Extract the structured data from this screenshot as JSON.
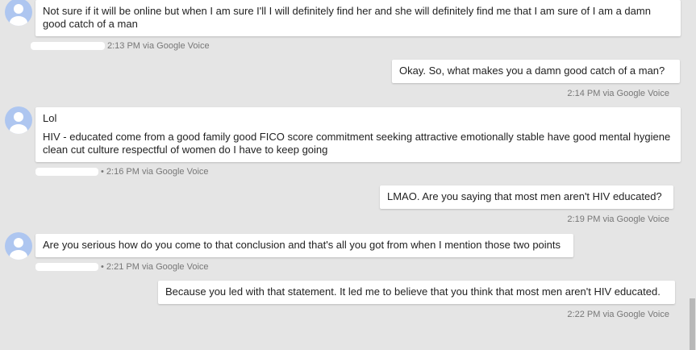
{
  "messages": [
    {
      "direction": "incoming",
      "paragraphs": [
        "Not sure if it will be online but when I am sure I'll I will definitely find her and she will definitely find me that I am sure of I am a damn good catch of a man"
      ],
      "time": "2:13 PM",
      "via": "via Google Voice"
    },
    {
      "direction": "outgoing",
      "paragraphs": [
        "Okay. So, what makes you a damn good catch of a man?"
      ],
      "time": "2:14 PM",
      "via": "via Google Voice"
    },
    {
      "direction": "incoming",
      "paragraphs": [
        "Lol",
        "HIV - educated come from a good family good FICO score commitment seeking attractive emotionally stable have good mental hygiene clean cut culture respectful of women do I have to keep going"
      ],
      "time": "2:16 PM",
      "via": "via Google Voice"
    },
    {
      "direction": "outgoing",
      "paragraphs": [
        "LMAO. Are you saying that most men aren't HIV educated?"
      ],
      "time": "2:19 PM",
      "via": "via Google Voice"
    },
    {
      "direction": "incoming",
      "paragraphs": [
        "Are you serious how do you come to that conclusion and that's all you got from when I mention those two points"
      ],
      "time": "2:21 PM",
      "via": "via Google Voice"
    },
    {
      "direction": "outgoing",
      "paragraphs": [
        "Because you led with that statement. It led me to believe that you think that most men aren't HIV educated."
      ],
      "time": "2:22 PM",
      "via": "via Google Voice"
    }
  ],
  "separator": "•",
  "icons": {
    "avatar": "default-person-avatar-icon"
  },
  "colors": {
    "background": "#e5e5e5",
    "bubble": "#ffffff",
    "avatar": "#aec6f0",
    "meta": "#777777"
  }
}
